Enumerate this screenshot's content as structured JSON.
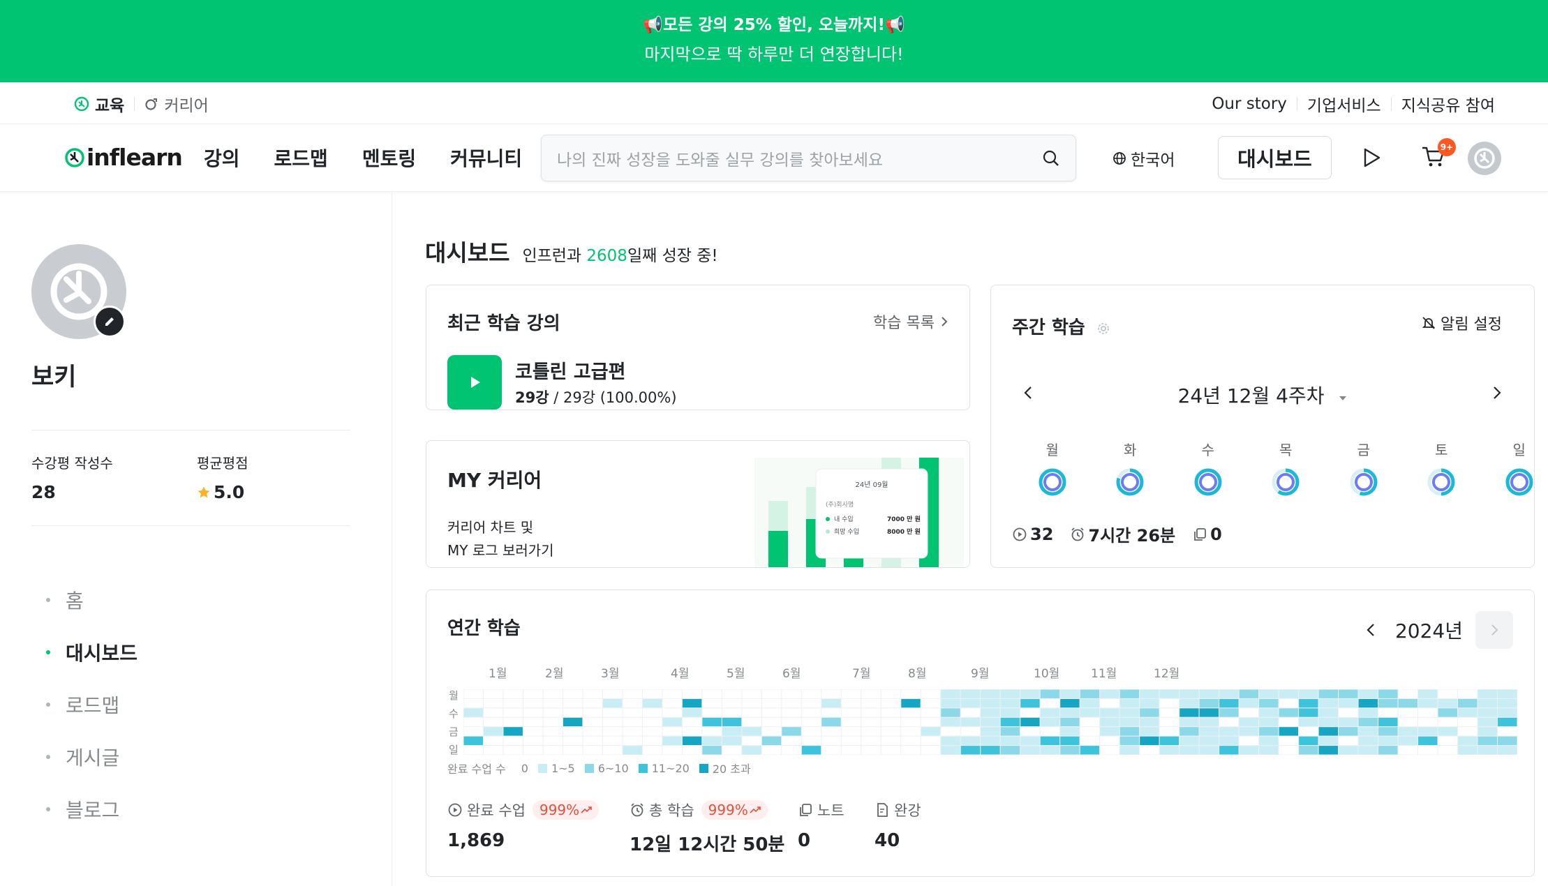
{
  "banner": {
    "line1": "📢모든 강의 25% 할인, 오늘까지!📢",
    "line2": "마지막으로 딱 하루만 더 연장합니다!"
  },
  "topbar": {
    "edu": "교육",
    "career": "커리어",
    "right_links": [
      "Our story",
      "기업서비스",
      "지식공유 참여"
    ]
  },
  "nav": {
    "logo": "inflearn",
    "menu": [
      "강의",
      "로드맵",
      "멘토링",
      "커뮤니티"
    ],
    "search_placeholder": "나의 진짜 성장을 도와줄 실무 강의를 찾아보세요",
    "language": "한국어",
    "dashboard_button": "대시보드",
    "cart_badge": "9+"
  },
  "profile": {
    "name": "보키",
    "reviews_label": "수강평 작성수",
    "reviews_value": "28",
    "rating_label": "평균평점",
    "rating_value": "5.0"
  },
  "side_nav": [
    {
      "label": "홈",
      "active": false
    },
    {
      "label": "대시보드",
      "active": true
    },
    {
      "label": "로드맵",
      "active": false
    },
    {
      "label": "게시글",
      "active": false
    },
    {
      "label": "블로그",
      "active": false
    }
  ],
  "dashboard": {
    "title": "대시보드",
    "subtitle_pre": "인프런과 ",
    "days": "2608",
    "subtitle_post": "일째 성장 중!"
  },
  "recent": {
    "title": "최근 학습 강의",
    "more": "학습 목록",
    "course_title": "코틀린 고급편",
    "progress_bold": "29강",
    "progress_rest": " / 29강 (100.00%)"
  },
  "career": {
    "title": "MY 커리어",
    "desc1": "커리어 차트 및",
    "desc2": "MY 로그 보러가기",
    "mini_card": {
      "date": "24년 09월",
      "company": "(주)회사명",
      "row1_label": "내 수입",
      "row1_value": "7000 만 원",
      "row2_label": "희망 수입",
      "row2_value": "8000 만 원"
    }
  },
  "weekly": {
    "title": "주간 학습",
    "alarm": "알림 설정",
    "week": "24년 12월 4주차",
    "days": [
      {
        "label": "월",
        "progress": 1.0
      },
      {
        "label": "화",
        "progress": 0.8
      },
      {
        "label": "수",
        "progress": 1.0
      },
      {
        "label": "목",
        "progress": 0.6
      },
      {
        "label": "금",
        "progress": 0.55
      },
      {
        "label": "토",
        "progress": 0.5
      },
      {
        "label": "일",
        "progress": 1.0
      }
    ],
    "lectures": "32",
    "time": "7시간 26분",
    "notes": "0"
  },
  "annual": {
    "title": "연간 학습",
    "year": "2024년",
    "months": [
      "1월",
      "2월",
      "3월",
      "4월",
      "5월",
      "6월",
      "7월",
      "8월",
      "9월",
      "10월",
      "11월",
      "12월"
    ],
    "day_labels": [
      "월",
      "수",
      "금",
      "일"
    ],
    "legend_title": "완료 수업 수",
    "legend": [
      {
        "label": "0",
        "color": "#ffffff"
      },
      {
        "label": "1~5",
        "color": "#c9edf4"
      },
      {
        "label": "6~10",
        "color": "#8ad8e8"
      },
      {
        "label": "11~20",
        "color": "#3ec3dc"
      },
      {
        "label": "20 초과",
        "color": "#16a6c4"
      }
    ],
    "stats": [
      {
        "label": "완료 수업",
        "pill": "999%",
        "value": "1,869"
      },
      {
        "label": "총 학습",
        "pill": "999%",
        "value": "12일 12시간 50분"
      },
      {
        "label": "노트",
        "pill": "",
        "value": "0"
      },
      {
        "label": "완강",
        "pill": "",
        "value": "40"
      }
    ]
  },
  "colors": {
    "brand": "#00c471",
    "badge": "#ff5722",
    "ring": "#6b7cf6",
    "ring_track": "#1cb8d8"
  }
}
